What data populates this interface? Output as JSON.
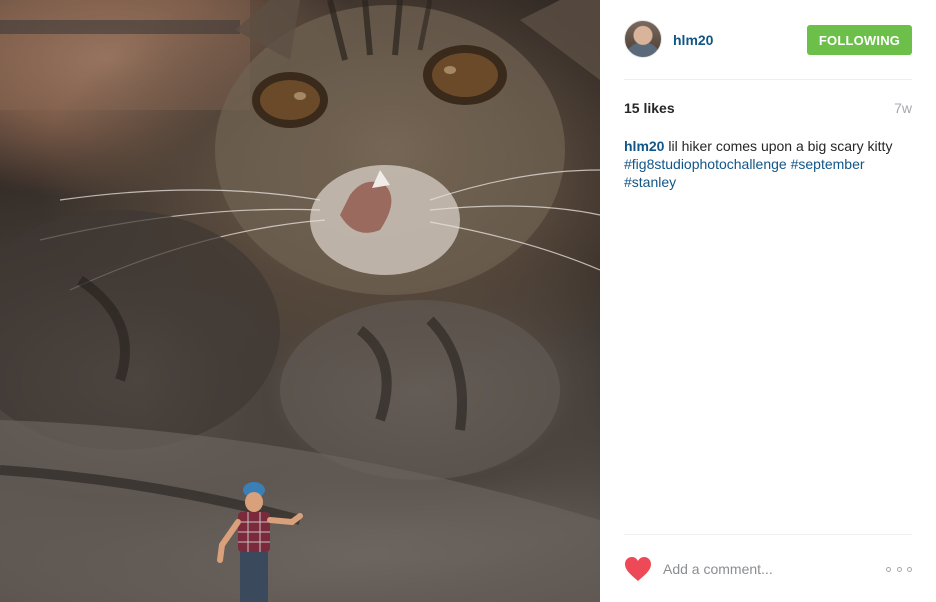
{
  "post": {
    "photo_alt": "tabby kitten with a tiny hiker figurine",
    "user": {
      "username": "hlm20",
      "avatar": "avatar-photo"
    },
    "follow_button": {
      "label": "FOLLOWING",
      "color": "#6cc04a"
    },
    "likes": "15 likes",
    "age": "7w",
    "caption": {
      "username": "hlm20",
      "text": "lil hiker comes upon a big scary kitty",
      "hashtags": [
        "#fig8studiophotochallenge",
        "#september",
        "#stanley"
      ]
    },
    "comment": {
      "placeholder": "Add a comment...",
      "like_icon": "heart-icon",
      "like_color": "#ed4956",
      "more_icon": "more-options-icon"
    },
    "link_color": "#125688"
  }
}
